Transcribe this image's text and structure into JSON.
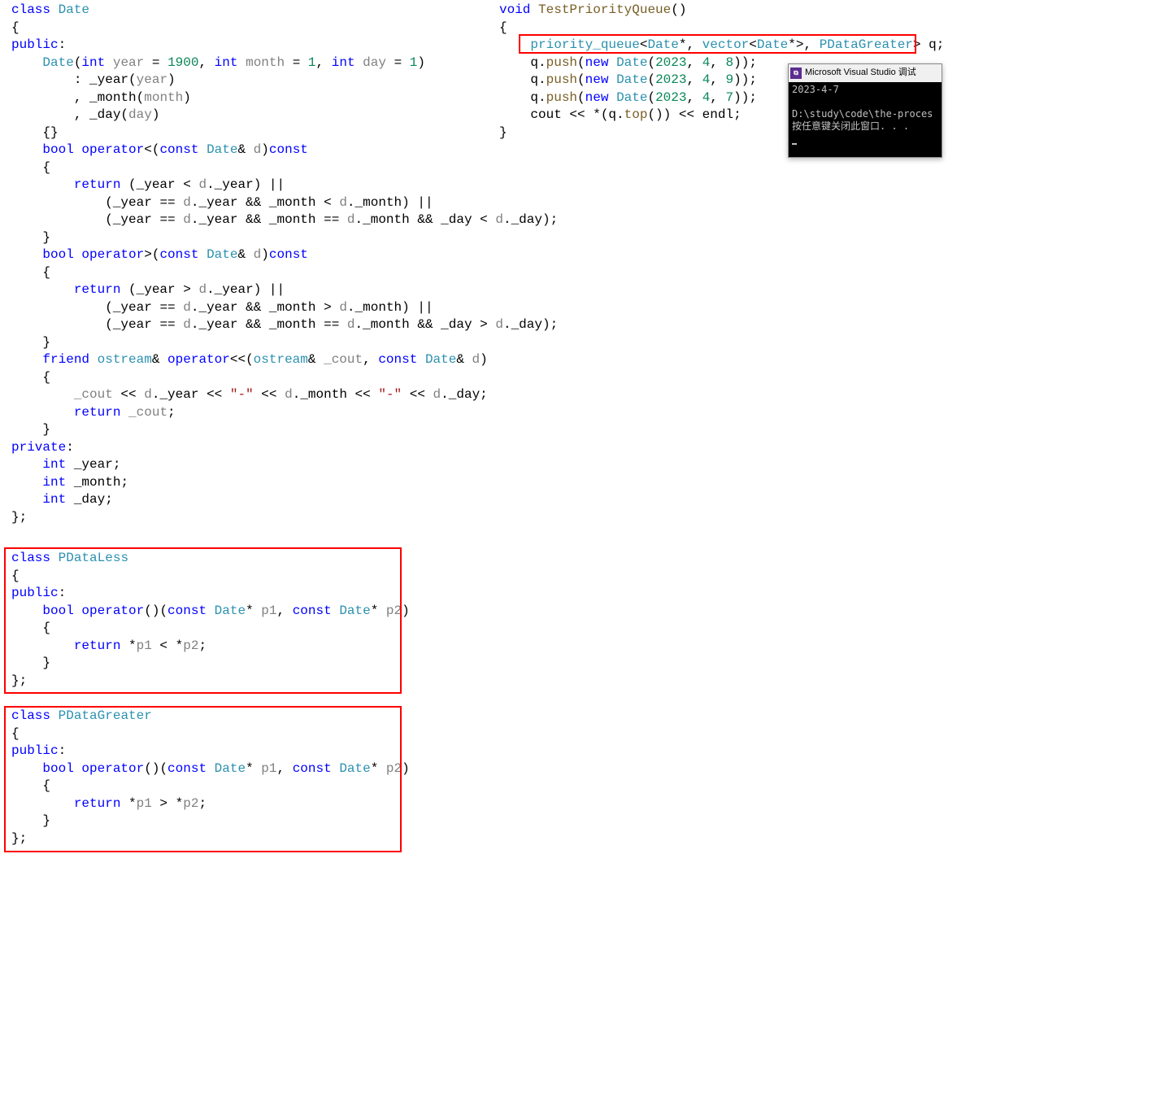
{
  "left": {
    "l1a": "class",
    "l1b": "Date",
    "l2": "{",
    "l3": "public",
    "l4a": "Date",
    "l4b": "int",
    "l4c": "year",
    "l4d": "1900",
    "l4e": "int",
    "l4f": "month",
    "l4g": "1",
    "l4h": "int",
    "l4i": "day",
    "l4j": "1",
    "l5a": "_year",
    "l5b": "year",
    "l6a": "_month",
    "l6b": "month",
    "l7a": "_day",
    "l7b": "day",
    "l8": "{}",
    "l9a": "bool",
    "l9b": "operator",
    "l9c": "const",
    "l9d": "Date",
    "l9e": "d",
    "l9f": "const",
    "l10": "{",
    "l11a": "return",
    "l11b": "_year",
    "l11c": "d",
    "l11d": "_year",
    "l12a": "_year",
    "l12b": "d",
    "l12c": "_year",
    "l12d": "_month",
    "l12e": "d",
    "l12f": "_month",
    "l13a": "_year",
    "l13b": "d",
    "l13c": "_year",
    "l13d": "_month",
    "l13e": "d",
    "l13f": "_month",
    "l13g": "_day",
    "l13h": "d",
    "l13i": "_day",
    "l14": "}",
    "l15a": "bool",
    "l15b": "operator",
    "l15c": "const",
    "l15d": "Date",
    "l15e": "d",
    "l15f": "const",
    "l16": "{",
    "l17a": "return",
    "l17b": "_year",
    "l17c": "d",
    "l17d": "_year",
    "l18a": "_year",
    "l18b": "d",
    "l18c": "_year",
    "l18d": "_month",
    "l18e": "d",
    "l18f": "_month",
    "l19a": "_year",
    "l19b": "d",
    "l19c": "_year",
    "l19d": "_month",
    "l19e": "d",
    "l19f": "_month",
    "l19g": "_day",
    "l19h": "d",
    "l19i": "_day",
    "l20": "}",
    "l21a": "friend",
    "l21b": "ostream",
    "l21c": "operator",
    "l21d": "ostream",
    "l21e": "_cout",
    "l21f": "const",
    "l21g": "Date",
    "l21h": "d",
    "l22": "{",
    "l23a": "_cout",
    "l23b": "d",
    "l23c": "_year",
    "l23d": "\"-\"",
    "l23e": "d",
    "l23f": "_month",
    "l23g": "\"-\"",
    "l23h": "d",
    "l23i": "_day",
    "l24a": "return",
    "l24b": "_cout",
    "l25": "}",
    "l26": "private",
    "l27a": "int",
    "l27b": "_year",
    "l28a": "int",
    "l28b": "_month",
    "l29a": "int",
    "l29b": "_day",
    "l30": "};"
  },
  "pless": {
    "l1a": "class",
    "l1b": "PDataLess",
    "l2": "{",
    "l3": "public",
    "l4a": "bool",
    "l4b": "operator",
    "l4c": "const",
    "l4d": "Date",
    "l4e": "p1",
    "l4f": "const",
    "l4g": "Date",
    "l4h": "p2",
    "l5": "{",
    "l6a": "return",
    "l6b": "p1",
    "l6c": "p2",
    "l7": "}",
    "l8": "};"
  },
  "pgreater": {
    "l1a": "class",
    "l1b": "PDataGreater",
    "l2": "{",
    "l3": "public",
    "l4a": "bool",
    "l4b": "operator",
    "l4c": "const",
    "l4d": "Date",
    "l4e": "p1",
    "l4f": "const",
    "l4g": "Date",
    "l4h": "p2",
    "l5": "{",
    "l6a": "return",
    "l6b": "p1",
    "l6c": "p2",
    "l7": "}",
    "l8": "};"
  },
  "right": {
    "l1a": "void",
    "l1b": "TestPriorityQueue",
    "l2": "{",
    "l3a": "priority_queue",
    "l3b": "Date",
    "l3c": "vector",
    "l3d": "Date",
    "l3e": "PDataGreater",
    "l3f": "q",
    "l4a": "q",
    "l4b": "push",
    "l4c": "new",
    "l4d": "Date",
    "l4e": "2023",
    "l4f": "4",
    "l4g": "8",
    "l5a": "q",
    "l5b": "push",
    "l5c": "new",
    "l5d": "Date",
    "l5e": "2023",
    "l5f": "4",
    "l5g": "9",
    "l6a": "q",
    "l6b": "push",
    "l6c": "new",
    "l6d": "Date",
    "l6e": "2023",
    "l6f": "4",
    "l6g": "7",
    "l7a": "cout",
    "l7b": "q",
    "l7c": "top",
    "l7d": "endl",
    "l8": "}"
  },
  "console": {
    "title": "Microsoft Visual Studio 调试",
    "icon": "⧉",
    "out1": "2023-4-7",
    "out2": "",
    "out3": "D:\\study\\code\\the-proces",
    "out4": "按任意键关闭此窗口. . ."
  }
}
